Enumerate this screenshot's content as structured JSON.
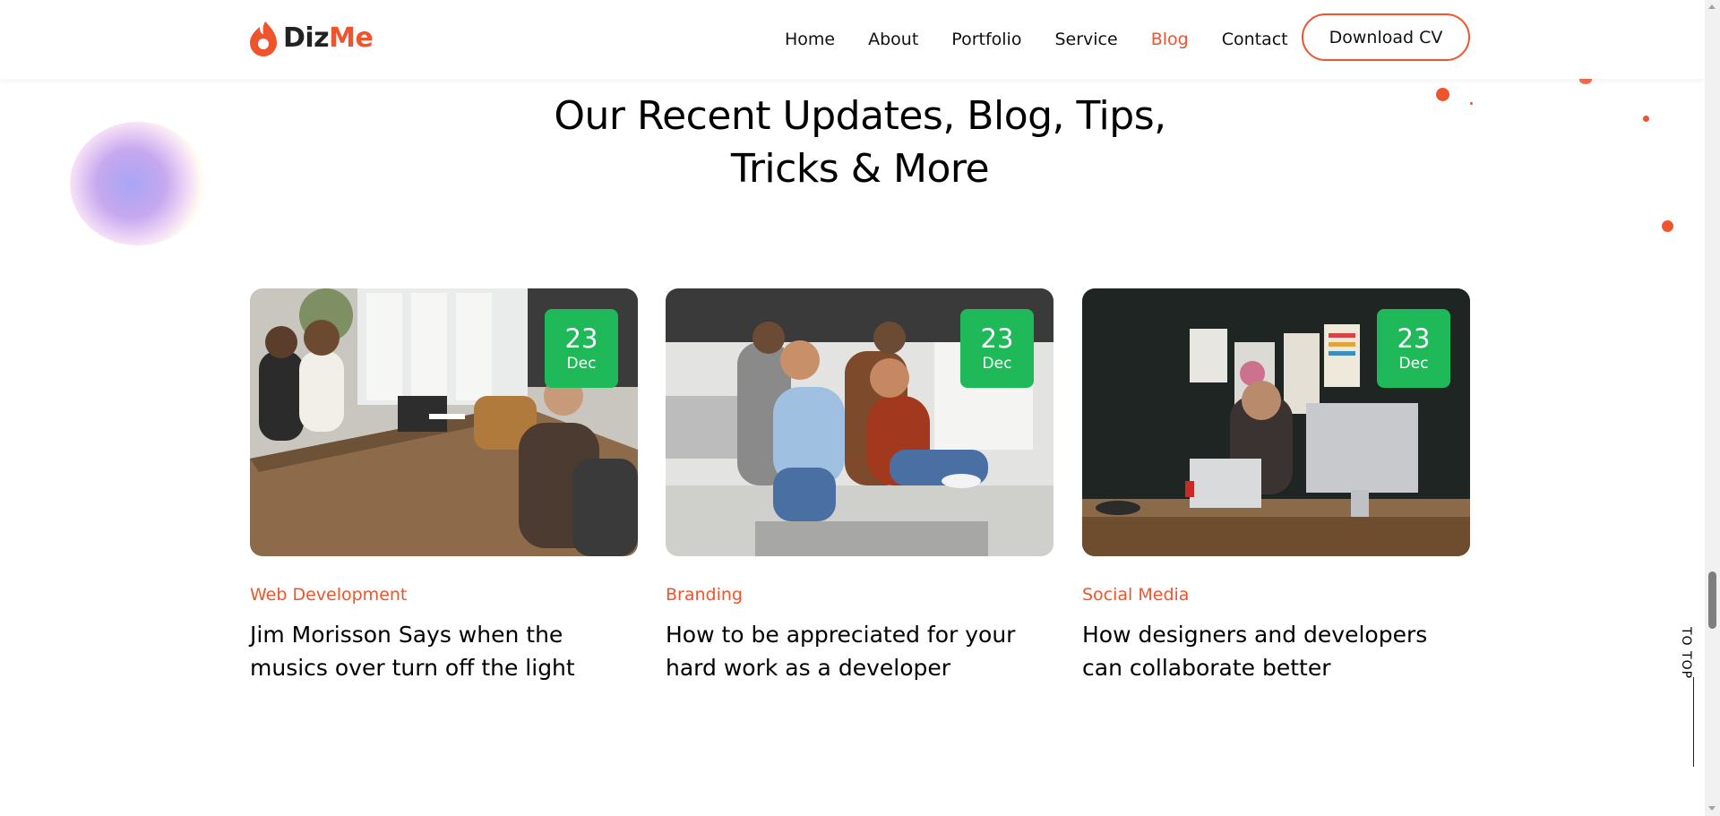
{
  "brand": {
    "logo_part1": "Diz",
    "logo_part2": "Me",
    "accent_color": "#f0542d",
    "badge_color": "#1fb95a"
  },
  "nav": {
    "items": [
      {
        "label": "Home"
      },
      {
        "label": "About"
      },
      {
        "label": "Portfolio"
      },
      {
        "label": "Service"
      },
      {
        "label": "Blog",
        "active": true
      },
      {
        "label": "Contact"
      }
    ],
    "cta_label": "Download CV"
  },
  "section": {
    "title_line1": "Our Recent Updates, Blog, Tips,",
    "title_line2": "Tricks & More"
  },
  "posts": [
    {
      "day": "23",
      "month": "Dec",
      "category": "Web Development",
      "title": "Jim Morisson Says when the musics over turn off the light",
      "image_icon": "office-meeting-photo"
    },
    {
      "day": "23",
      "month": "Dec",
      "category": "Branding",
      "title": "How to be appreciated for your hard work as a developer",
      "image_icon": "team-celebrating-photo"
    },
    {
      "day": "23",
      "month": "Dec",
      "category": "Social Media",
      "title": "How designers and developers can collaborate better",
      "image_icon": "designer-at-desk-photo"
    }
  ],
  "to_top": {
    "label": "TO TOP"
  }
}
